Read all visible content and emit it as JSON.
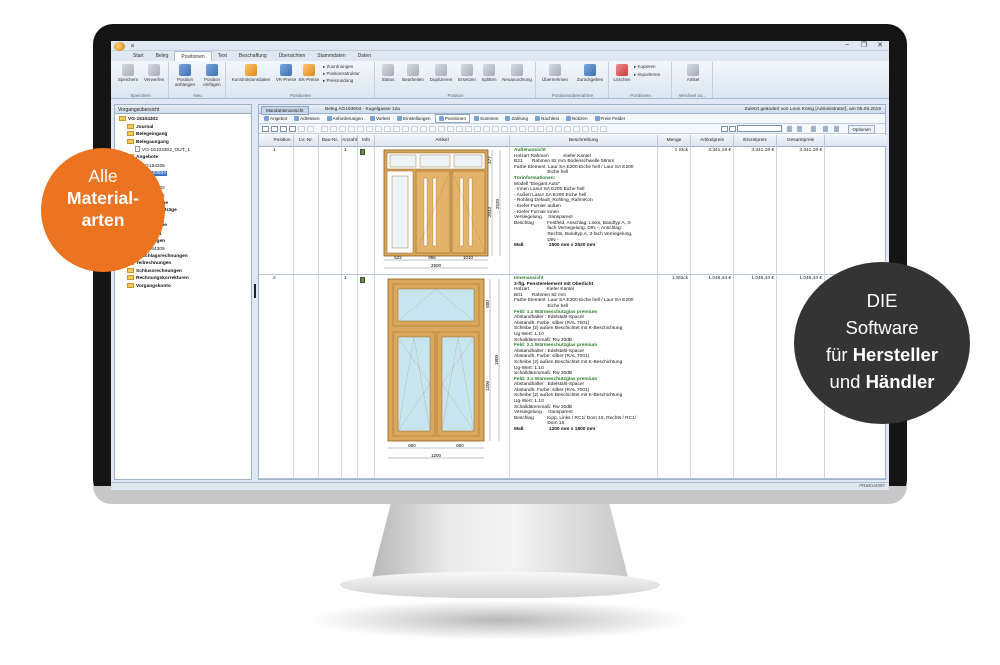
{
  "window": {
    "title": "a",
    "controls": [
      "‒",
      "❐",
      "✕"
    ]
  },
  "menu": {
    "tabs": [
      "Start",
      "Beleg",
      "Positionen",
      "Text",
      "Beschaffung",
      "Übersichten",
      "Stammdaten",
      "Daten"
    ],
    "active": "Positionen"
  },
  "ribbon": {
    "groups": [
      {
        "label": "Speichern",
        "buttons": [
          "Speichern",
          "Verwerfen"
        ]
      },
      {
        "label": "Neu",
        "buttons": [
          "Position anhängen",
          "Position einfügen"
        ]
      },
      {
        "label": "Positionen",
        "buttons": [
          "Konstruktionsdaten",
          "VK-Preise",
          "EK-Preise"
        ],
        "small": [
          "Zuordnungen",
          "Positionsstruktur",
          "Preisrundung"
        ]
      },
      {
        "label": "Position",
        "buttons": [
          "Status",
          "Bearbeiten",
          "Duplizieren",
          "Ersetzen",
          "Splitten",
          "Neuanordnung"
        ]
      },
      {
        "label": "Positionsübernahme",
        "buttons": [
          "Übernehmen",
          "Zurückgeben"
        ]
      },
      {
        "label": "Positionen",
        "buttons": [
          "Löschen"
        ],
        "small": [
          "Kopieren",
          "Importieren"
        ]
      },
      {
        "label": "Wechsel zu...",
        "buttons": [
          "Artikel"
        ]
      }
    ]
  },
  "left_pane": {
    "title": "Vorgangsübersicht",
    "tree": [
      {
        "label": "VG-16104302",
        "level": 0,
        "kind": "folder",
        "bold": true
      },
      {
        "label": "Journal",
        "level": 1,
        "kind": "folder",
        "bold": true
      },
      {
        "label": "Belegeingang",
        "level": 1,
        "kind": "folder",
        "bold": true
      },
      {
        "label": "Belegausgang",
        "level": 1,
        "kind": "folder",
        "bold": true
      },
      {
        "label": "VG-16104302_OUT_1",
        "level": 2,
        "kind": "doc"
      },
      {
        "label": "Angebote",
        "level": 1,
        "kind": "folder",
        "bold": true
      },
      {
        "label": "AG164305",
        "level": 2,
        "kind": "doc"
      },
      {
        "label": "AG193604",
        "level": 2,
        "kind": "doc",
        "selected": true
      },
      {
        "label": "aufträge",
        "level": 1,
        "kind": "folder",
        "bold": true
      },
      {
        "label": "AU164303",
        "level": 2,
        "kind": "doc"
      },
      {
        "label": "AU172202",
        "level": 2,
        "kind": "doc"
      },
      {
        "label": "triebsaufträge",
        "level": 1,
        "kind": "folder",
        "bold": true
      },
      {
        "label": "ertigungsaufträge",
        "level": 1,
        "kind": "folder",
        "bold": true
      },
      {
        "label": "F164407",
        "level": 2,
        "kind": "doc"
      },
      {
        "label": "Lieferscheine",
        "level": 1,
        "kind": "folder",
        "bold": true
      },
      {
        "label": "LI164901",
        "level": 2,
        "kind": "doc"
      },
      {
        "label": "Rechnungen",
        "level": 1,
        "kind": "folder",
        "bold": true
      },
      {
        "label": "RE164305",
        "level": 2,
        "kind": "doc"
      },
      {
        "label": "Abschlagsrechnungen",
        "level": 1,
        "kind": "folder",
        "bold": true
      },
      {
        "label": "Teilrechnungen",
        "level": 1,
        "kind": "folder",
        "bold": true
      },
      {
        "label": "Schlussrechnungen",
        "level": 1,
        "kind": "folder",
        "bold": true
      },
      {
        "label": "Rechnungskorrekturen",
        "level": 1,
        "kind": "folder",
        "bold": true
      },
      {
        "label": "Vorgangskonto",
        "level": 1,
        "kind": "folder",
        "bold": true
      }
    ]
  },
  "document": {
    "tab": "Mandantenansicht",
    "title": "Beleg AG193604 - Kugelgasse 12a",
    "changed": "Zuletzt geändert von Leon König [Administrator], am 05.09.2019",
    "subtabs": [
      "Angebot",
      "Adressen",
      "Anforderungen",
      "Vorlest",
      "Einstellungen",
      "Positionen",
      "Summen",
      "Zahlung",
      "Nachlest",
      "Notizen",
      "Freie Felder"
    ],
    "active_subtab": "Positionen",
    "options_label": "Optionen"
  },
  "grid": {
    "columns": [
      "Position",
      "LV.-Nr.",
      "Bau-Nr.",
      "Anzahl",
      "Info",
      "Artikel",
      "Beschreibung",
      "Menge",
      "Artikelpreis",
      "Einzelpreis",
      "Gesamtpreis"
    ],
    "rows": [
      {
        "position": "1",
        "anzahl": "1",
        "menge": "1 Stck",
        "artikelpreis": "3.341,18 €",
        "einzelpreis": "3.341,18 €",
        "gesamtpreis": "3.341,18 €",
        "drawing": {
          "widths": [
            "522",
            "966",
            "1010"
          ],
          "total_width": "2500",
          "heights": [
            "477",
            "2043"
          ],
          "total_height": "2520"
        },
        "description": [
          {
            "t": "Außenansicht",
            "s": "h"
          },
          {
            "t": "Holzart Rahmen           Kiefer Kantel"
          },
          {
            "t": "B21       Rahmen 82 mm Bodenschwelle 58mm"
          },
          {
            "t": "Farbe Element  Laur SA E200 Eiche hell / Laur SA E200"
          },
          {
            "t": "                         Eiche hell"
          },
          {
            "t": "Türinformationen:",
            "s": "h"
          },
          {
            "t": "Modell \"Elegant Auto\""
          },
          {
            "t": "- Innen Lasur SA E200 Eiche hell"
          },
          {
            "t": "- Außen Lasur SA E200 Eiche hell"
          },
          {
            "t": "- Rohling Default_Rohling_RahmKon"
          },
          {
            "t": "- Kiefer Furnier außen"
          },
          {
            "t": "- Kiefer Furnier innen"
          },
          {
            "t": "Versiegelung     transparent"
          },
          {
            "t": "Beschlag          Festfeld, Anschlag: Links, Bandtyp A, 3-"
          },
          {
            "t": "                         fach Verriegelung, DIN -, Anschlag:"
          },
          {
            "t": "                         Rechts, Bandtyp A, 3-fach Verriegelung,"
          },
          {
            "t": "                         DIN -"
          },
          {
            "t": "Maß                   2500 mm x 2520 mm",
            "s": "b"
          }
        ]
      },
      {
        "position": "2",
        "anzahl": "1",
        "menge": "1 Stück",
        "artikelpreis": "1.046,44 €",
        "einzelpreis": "1.046,44 €",
        "gesamtpreis": "1.046,44 €",
        "drawing": {
          "widths": [
            "600",
            "600"
          ],
          "total_width": "1200",
          "heights": [
            "600",
            "1200"
          ],
          "total_height": "1800"
        },
        "description": [
          {
            "t": "Innenansicht",
            "s": "h"
          },
          {
            "t": "3-flg. Fensterelement mit Oberlicht",
            "s": "b"
          },
          {
            "t": "Holzart             Kiefer Kantel"
          },
          {
            "t": "B01       Rahmen 82 mm"
          },
          {
            "t": "Farbe Element  Laur SA E200 Eiche hell / Laur SA E200"
          },
          {
            "t": "                         Eiche hell"
          },
          {
            "t": "Feld: 1.1 Wärmeschutzglas premium",
            "s": "h"
          },
          {
            "t": "Abstandhalter : Edelstahl-Spacer"
          },
          {
            "t": "Abstandh. Farbe: silber (RAL 7001)"
          },
          {
            "t": "Scheibe (2) außen Beschichtet mit K-Beschichtung"
          },
          {
            "t": "Ug-Wert: 1.10"
          },
          {
            "t": "Schalldämmmaß: Rw 30dB"
          },
          {
            "t": "Feld: 2.1 Wärmeschutzglas premium",
            "s": "h"
          },
          {
            "t": "Abstandhalter : Edelstahl-Spacer"
          },
          {
            "t": "Abstandh. Farbe: silber (RAL 7001)"
          },
          {
            "t": "Scheibe (2) außen Beschichtet mit K-Beschichtung"
          },
          {
            "t": "Ug-Wert: 1.10"
          },
          {
            "t": "Schalldämmmaß: Rw 30dB"
          },
          {
            "t": "Feld: 3.1 Wärmeschutzglas premium",
            "s": "h"
          },
          {
            "t": "Abstandhalter : Edelstahl-Spacer"
          },
          {
            "t": "Abstandh. Farbe: silber (RAL 7001)"
          },
          {
            "t": "Scheibe (2) außen Beschichtet mit K-Beschichtung"
          },
          {
            "t": "Ug-Wert: 1.10"
          },
          {
            "t": "Schalldämmmaß: Rw 30dB"
          },
          {
            "t": "Versiegelung     transparent"
          },
          {
            "t": "Beschlag          Kipp, Links / RC1/ Dom 15, Rechts / RC1/"
          },
          {
            "t": "                         Dom 15"
          },
          {
            "t": "Maß                   1200 mm x 1800 mm",
            "s": "b"
          }
        ]
      }
    ]
  },
  "statusbar": {
    "text": "PR&Ex/4097"
  },
  "badges": {
    "left": [
      "Alle",
      "Material-",
      "arten"
    ],
    "right": {
      "line1": "DIE",
      "line2": "Software",
      "line3_pre": "für",
      "line3_bold": "Hersteller",
      "line4_pre": "und",
      "line4_bold": "Händler"
    }
  },
  "colors": {
    "accent_orange": "#ec7320",
    "badge_dark": "#343434",
    "frame_wood": "#d9a85c",
    "heading_green": "#2f7d2f",
    "selection_blue": "#3d6fc4"
  }
}
